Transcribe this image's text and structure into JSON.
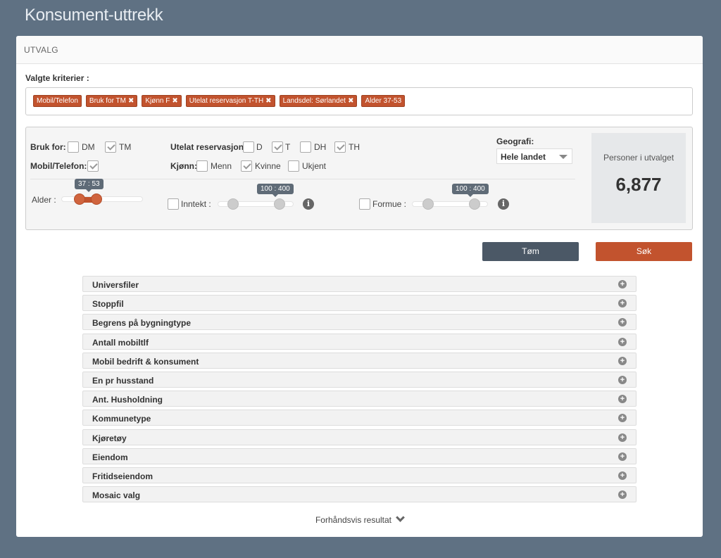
{
  "page": {
    "title": "Konsument-uttrekk"
  },
  "panel": {
    "title": "UTVALG"
  },
  "criteria": {
    "label": "Valgte kriterier :",
    "tags": [
      {
        "label": "Mobil/Telefon",
        "removable": false
      },
      {
        "label": "Bruk for TM",
        "removable": true
      },
      {
        "label": "Kjønn F",
        "removable": true
      },
      {
        "label": "Utelat reservasjon T-TH",
        "removable": true
      },
      {
        "label": "Landsdel: Sørlandet",
        "removable": true
      },
      {
        "label": "Alder 37-53",
        "removable": false
      }
    ]
  },
  "filters": {
    "bruk_for": {
      "label": "Bruk for:",
      "dm": "DM",
      "tm": "TM"
    },
    "mobil": {
      "label": "Mobil/Telefon:"
    },
    "utelat": {
      "label": "Utelat reservasjon:",
      "d": "D",
      "t": "T",
      "dh": "DH",
      "th": "TH"
    },
    "kjonn": {
      "label": "Kjønn:",
      "menn": "Menn",
      "kvinne": "Kvinne",
      "ukjent": "Ukjent"
    },
    "geografi": {
      "label": "Geografi:",
      "value": "Hele landet"
    },
    "alder": {
      "label": "Alder :",
      "range": "37 : 53",
      "min": 37,
      "max": 53
    },
    "inntekt": {
      "label": "Inntekt :",
      "range": "100 : 400",
      "min": 100,
      "max": 400
    },
    "formue": {
      "label": "Formue :",
      "range": "100 : 400",
      "min": 100,
      "max": 400
    }
  },
  "result": {
    "label": "Personer i utvalget",
    "count": "6,877"
  },
  "actions": {
    "clear": "Tøm",
    "search": "Søk"
  },
  "accordion": [
    "Universfiler",
    "Stoppfil",
    "Begrens på bygningtype",
    "Antall mobiltlf",
    "Mobil bedrift & konsument",
    "En pr husstand",
    "Ant. Husholdning",
    "Kommunetype",
    "Kjøretøy",
    "Eiendom",
    "Fritidseiendom",
    "Mosaic valg"
  ],
  "preview": {
    "label": "Forhåndsvis resultat"
  },
  "colors": {
    "accent": "#c2532e",
    "background": "#5f7183",
    "dark_button": "#4b5866"
  }
}
